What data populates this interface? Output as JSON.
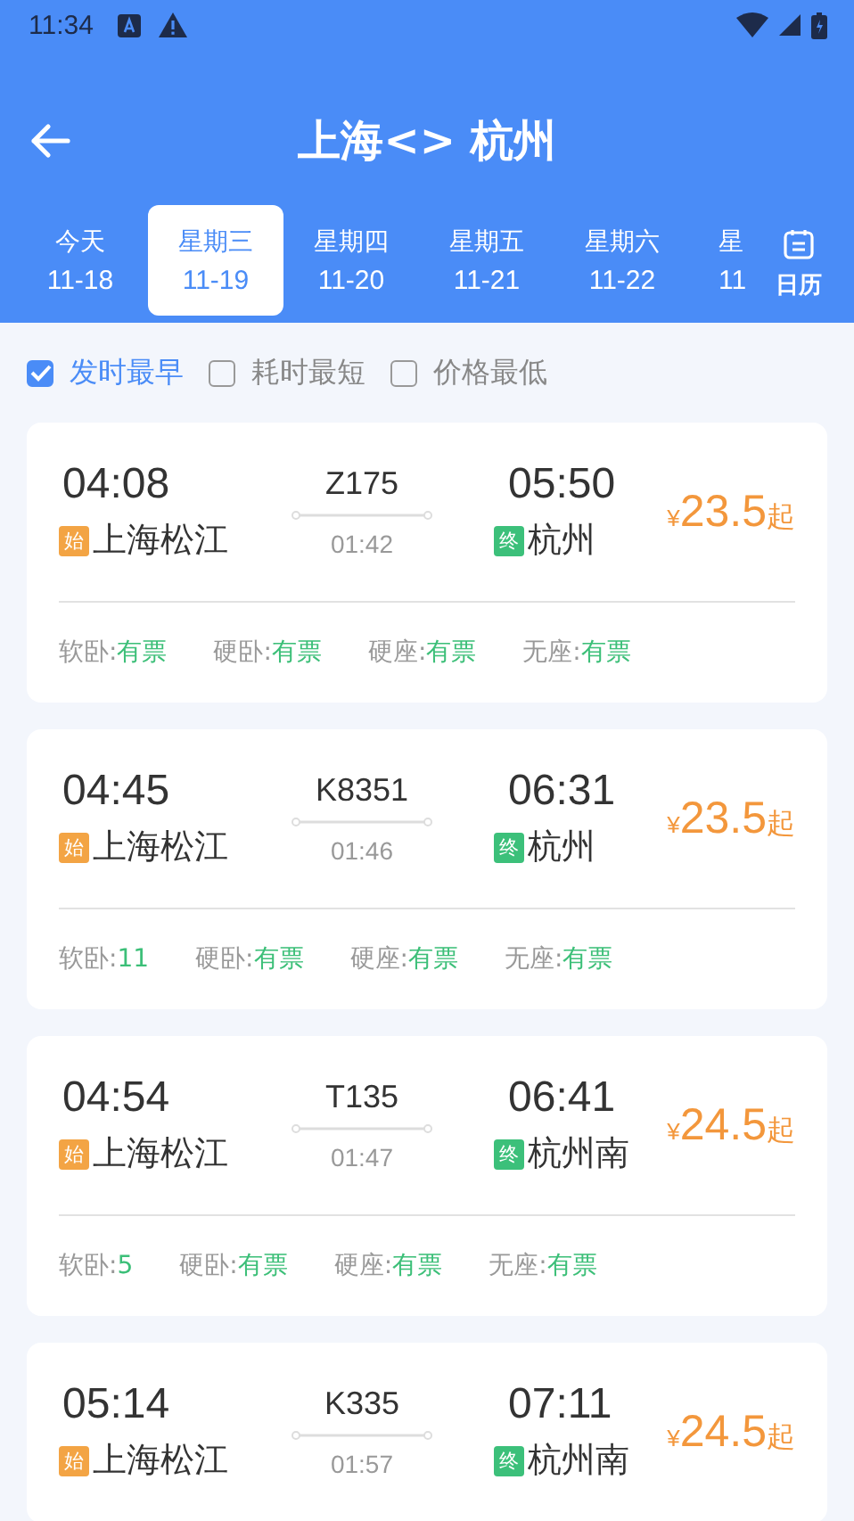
{
  "status_bar": {
    "time": "11:34"
  },
  "header": {
    "title": "上海<> 杭州"
  },
  "date_tabs": [
    {
      "week": "今天",
      "date": "11-18",
      "selected": false
    },
    {
      "week": "星期三",
      "date": "11-19",
      "selected": true
    },
    {
      "week": "星期四",
      "date": "11-20",
      "selected": false
    },
    {
      "week": "星期五",
      "date": "11-21",
      "selected": false
    },
    {
      "week": "星期六",
      "date": "11-22",
      "selected": false
    },
    {
      "week": "星",
      "date": "11",
      "selected": false
    }
  ],
  "calendar_button": {
    "label": "日历"
  },
  "sort_options": [
    {
      "label": "发时最早",
      "checked": true
    },
    {
      "label": "耗时最短",
      "checked": false
    },
    {
      "label": "价格最低",
      "checked": false
    }
  ],
  "trains": [
    {
      "depart_time": "04:08",
      "depart_badge": "始",
      "depart_station": "上海松江",
      "train_no": "Z175",
      "duration": "01:42",
      "arrive_time": "05:50",
      "arrive_badge": "终",
      "arrive_station": "杭州",
      "currency": "¥",
      "price": "23.5",
      "price_suffix": "起",
      "seats": [
        {
          "label": "软卧:",
          "value": "有票"
        },
        {
          "label": "硬卧:",
          "value": "有票"
        },
        {
          "label": "硬座:",
          "value": "有票"
        },
        {
          "label": "无座:",
          "value": "有票"
        }
      ]
    },
    {
      "depart_time": "04:45",
      "depart_badge": "始",
      "depart_station": "上海松江",
      "train_no": "K8351",
      "duration": "01:46",
      "arrive_time": "06:31",
      "arrive_badge": "终",
      "arrive_station": "杭州",
      "currency": "¥",
      "price": "23.5",
      "price_suffix": "起",
      "seats": [
        {
          "label": "软卧:",
          "value": "11"
        },
        {
          "label": "硬卧:",
          "value": "有票"
        },
        {
          "label": "硬座:",
          "value": "有票"
        },
        {
          "label": "无座:",
          "value": "有票"
        }
      ]
    },
    {
      "depart_time": "04:54",
      "depart_badge": "始",
      "depart_station": "上海松江",
      "train_no": "T135",
      "duration": "01:47",
      "arrive_time": "06:41",
      "arrive_badge": "终",
      "arrive_station": "杭州南",
      "currency": "¥",
      "price": "24.5",
      "price_suffix": "起",
      "seats": [
        {
          "label": "软卧:",
          "value": "5"
        },
        {
          "label": "硬卧:",
          "value": "有票"
        },
        {
          "label": "硬座:",
          "value": "有票"
        },
        {
          "label": "无座:",
          "value": "有票"
        }
      ]
    },
    {
      "depart_time": "05:14",
      "depart_badge": "始",
      "depart_station": "上海松江",
      "train_no": "K335",
      "duration": "01:57",
      "arrive_time": "07:11",
      "arrive_badge": "终",
      "arrive_station": "杭州南",
      "currency": "¥",
      "price": "24.5",
      "price_suffix": "起"
    }
  ]
}
